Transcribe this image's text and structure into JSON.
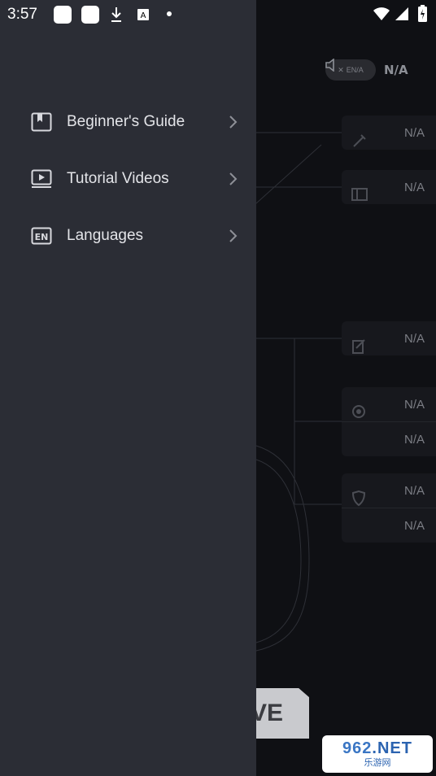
{
  "status_bar": {
    "time": "3:57",
    "icons": [
      "app-notification-icon",
      "app-notification-icon",
      "download-icon",
      "translate-icon",
      "dot-icon",
      "wifi-icon",
      "signal-icon",
      "battery-charging-icon"
    ]
  },
  "drawer": {
    "items": [
      {
        "label": "Beginner's Guide",
        "icon": "book-icon"
      },
      {
        "label": "Tutorial Videos",
        "icon": "video-icon"
      },
      {
        "label": "Languages",
        "icon": "language-en-icon",
        "icon_text": "EN"
      }
    ]
  },
  "background": {
    "lang_pill": "EN/A",
    "volume_value": "N/A",
    "stats": [
      {
        "icon": "pen-icon",
        "value": "N/A"
      },
      {
        "icon": "panel-icon",
        "value": "N/A"
      },
      {
        "icon": "edit-icon",
        "value": "N/A"
      },
      {
        "icon": "target-icon",
        "value": "N/A"
      },
      {
        "icon": "",
        "value": "N/A"
      },
      {
        "icon": "shield-icon",
        "value": "N/A"
      },
      {
        "icon": "",
        "value": "N/A"
      }
    ],
    "action_button": "VE"
  },
  "watermark": {
    "brand": "962",
    "suffix": ".NET",
    "subtitle": "乐游网"
  },
  "colors": {
    "drawer": "#2b2d35",
    "background": "#0f1014",
    "text": "#e3e4e8",
    "muted": "#7b7d84"
  }
}
